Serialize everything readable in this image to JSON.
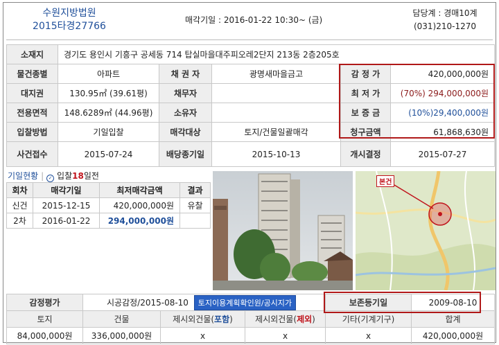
{
  "header": {
    "court": "수원지방법원",
    "case_no": "2015타경27766",
    "sale_date_label": "매각기일 : 2016-01-22  10:30~ (금)",
    "dept": "담당계 : 경매10계",
    "phone": "(031)210-1270"
  },
  "info": {
    "address_label": "소재지",
    "address": "경기도 용인시 기흥구 공세동 714 탑실마을대주피오레2단지 213동 2층205호",
    "type_label": "물건종별",
    "type": "아파트",
    "creditor_label": "채 권 자",
    "creditor": "광명새마을금고",
    "appraisal_label": "감 정 가",
    "appraisal": "420,000,000원",
    "land_label": "대지권",
    "land": "130.95㎡ (39.61평)",
    "debtor_label": "채무자",
    "debtor": "",
    "min_price_label": "최 저 가",
    "min_price": "(70%) 294,000,000원",
    "area_label": "전용면적",
    "area": "148.6289㎡ (44.96평)",
    "owner_label": "소유자",
    "owner": "",
    "deposit_label": "보 증 금",
    "deposit": "(10%)29,400,000원",
    "bid_method_label": "입찰방법",
    "bid_method": "기일입찰",
    "sale_target_label": "매각대상",
    "sale_target": "토지/건물일괄매각",
    "claim_label": "청구금액",
    "claim": "61,868,630원",
    "received_label": "사건접수",
    "received": "2015-07-24",
    "deadline_label": "배당종기일",
    "deadline": "2015-10-13",
    "start_label": "개시결정",
    "start": "2015-07-27"
  },
  "history": {
    "title": "기일현황",
    "sep": "|",
    "icon_glyph": "✓",
    "days_prefix": "입찰",
    "days_count": "18",
    "days_suffix": "일전",
    "columns": [
      "회차",
      "매각기일",
      "최저매각금액",
      "결과"
    ],
    "rows": [
      {
        "round": "신건",
        "date": "2015-12-15",
        "price": "420,000,000원",
        "result": "유찰"
      },
      {
        "round": "2차",
        "date": "2016-01-22",
        "price": "294,000,000원",
        "result": ""
      }
    ]
  },
  "map": {
    "badge": "본건"
  },
  "appraisal": {
    "label": "감정평가",
    "value": "시공감정/2015-08-10",
    "button": "토지이용계획확인원/공시지가",
    "reg_label": "보존등기일",
    "reg_date": "2009-08-10",
    "columns": [
      "토지",
      "건물",
      "제시외건물(",
      "포함",
      ")",
      "제시외건물(",
      "제외",
      ")",
      "기타(기계기구)",
      "합계"
    ],
    "values": [
      "84,000,000원",
      "336,000,000원",
      "x",
      "x",
      "x",
      "420,000,000원"
    ]
  },
  "colors": {
    "accent": "#1f4f9a",
    "highlight": "#b01818",
    "button": "#2a62c4"
  }
}
